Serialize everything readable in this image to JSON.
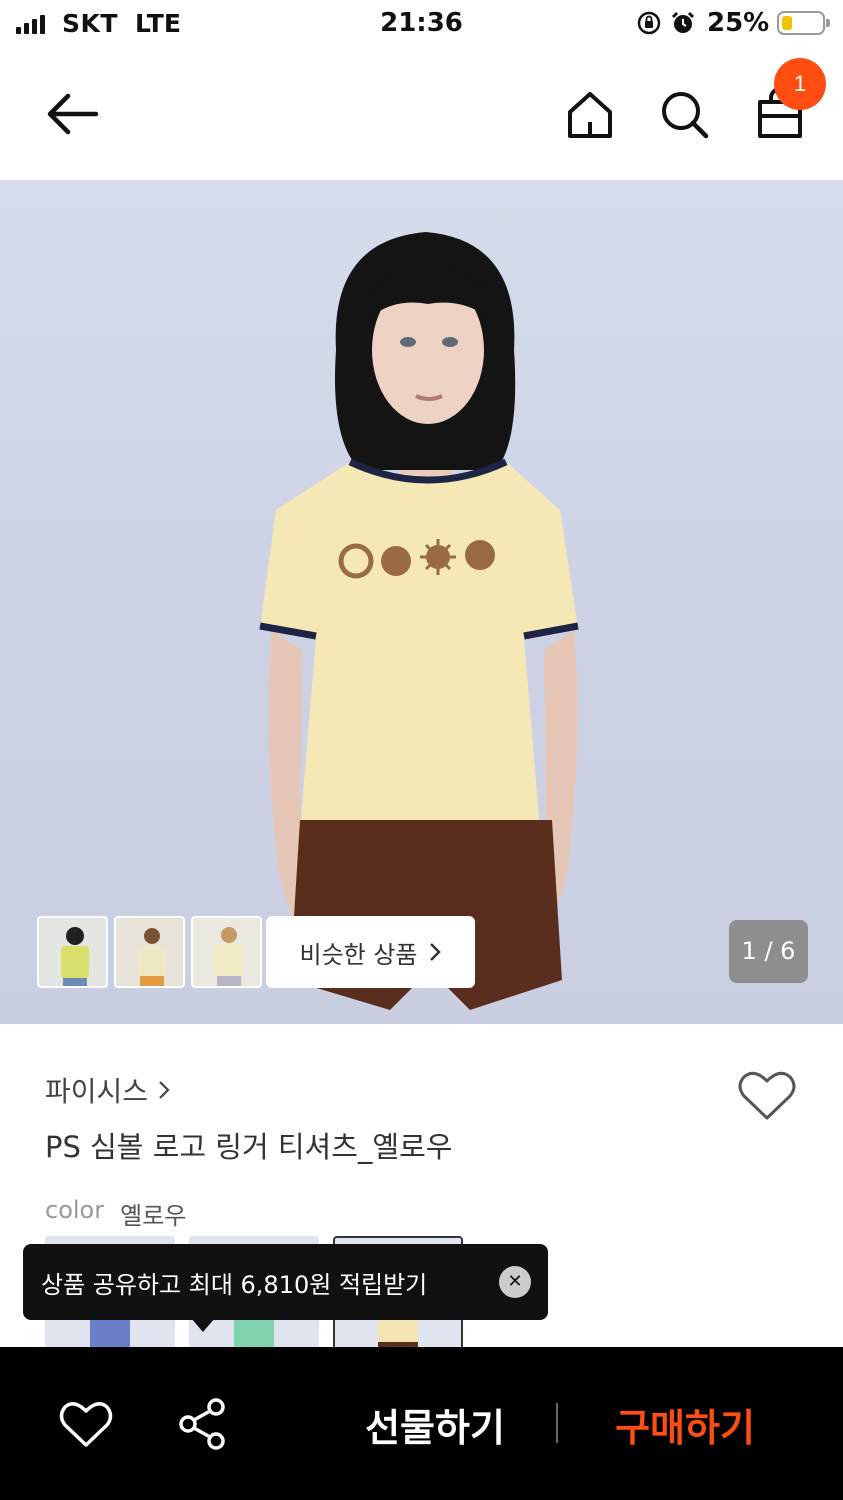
{
  "status_bar": {
    "carrier": "SKT",
    "network": "LTE",
    "time": "21:36",
    "battery_percent": "25%",
    "icons": [
      "signal-icon",
      "rotation-lock-icon",
      "alarm-icon",
      "battery-icon"
    ]
  },
  "nav": {
    "icons": [
      "back-arrow-icon",
      "home-icon",
      "search-icon",
      "shopping-bag-icon"
    ],
    "cart_count": "1",
    "accent_color": "#ff4e12"
  },
  "gallery": {
    "similar_label": "비슷한 상품",
    "counter": "1 / 6",
    "thumbnail_count": 3
  },
  "product": {
    "brand": "파이시스",
    "title": "PS 심볼 로고 링거 티셔츠_옐로우",
    "color_label": "color",
    "color_value": "옐로우"
  },
  "tooltip": {
    "text": "상품 공유하고 최대 6,810원 적립받기"
  },
  "bottom_bar": {
    "gift_label": "선물하기",
    "buy_label": "구매하기",
    "buy_color": "#ff4e12"
  }
}
